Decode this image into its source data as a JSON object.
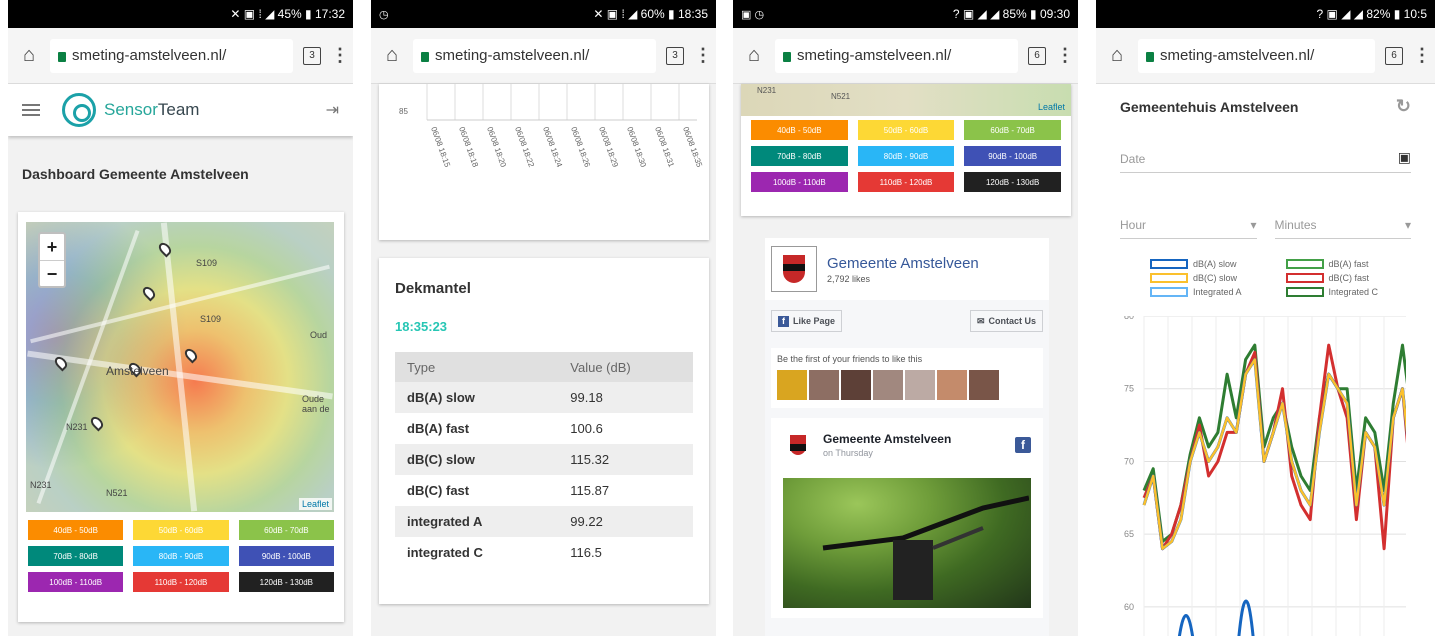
{
  "phones": [
    {
      "status": {
        "left": "",
        "text": "✕ ▣ ⁞ ◢ 45% ▮ 17:32"
      },
      "url": "smeting-amstelveen.nl/",
      "tabs": "3",
      "app": {
        "brand_a": "Sensor",
        "brand_b": "Team"
      },
      "dashboard_title": "Dashboard Gemeente Amstelveen",
      "map": {
        "labels": [
          "S109",
          "S109",
          "Amstelveen",
          "N231",
          "N231",
          "N521",
          "Oud",
          "Oude aan de"
        ],
        "attribution": "Leaflet"
      }
    },
    {
      "status": {
        "left": "◷",
        "text": "✕ ▣ ⁞ ◢ 60% ▮ 18:35"
      },
      "url": "smeting-amstelveen.nl/",
      "tabs": "3",
      "chart": {
        "ytick": "85",
        "xticks": [
          "06/08 18:15",
          "06/08 18:18",
          "06/08 18:20",
          "06/08 18:22",
          "06/08 18:24",
          "06/08 18:26",
          "06/08 18:29",
          "06/08 18:30",
          "06/08 18:31",
          "06/08 18:35"
        ]
      },
      "dekmantel": {
        "title": "Dekmantel",
        "time": "18:35:23",
        "col_type": "Type",
        "col_value": "Value (dB)",
        "rows": [
          {
            "type": "dB(A) slow",
            "value": "99.18"
          },
          {
            "type": "dB(A) fast",
            "value": "100.6"
          },
          {
            "type": "dB(C) slow",
            "value": "115.32"
          },
          {
            "type": "dB(C) fast",
            "value": "115.87"
          },
          {
            "type": "integrated A",
            "value": "99.22"
          },
          {
            "type": "integrated C",
            "value": "116.5"
          }
        ]
      }
    },
    {
      "status": {
        "left": "▣ ◷",
        "text": "? ▣ ◢ ◢ 85% ▮ 09:30"
      },
      "url": "smeting-amstelveen.nl/",
      "tabs": "6",
      "map_labels": [
        "N231",
        "N521",
        "Leaflet"
      ],
      "facebook": {
        "page_name": "Gemeente Amstelveen",
        "likes": "2,792 likes",
        "like_button": "Like Page",
        "contact_button": "Contact Us",
        "first_text": "Be the first of your friends to like this",
        "post_name": "Gemeente Amstelveen",
        "post_date": "on Thursday"
      }
    },
    {
      "status": {
        "left": "",
        "text": "? ▣ ◢ ◢ 82% ▮ 10:5"
      },
      "url": "smeting-amstelveen.nl/",
      "tabs": "6",
      "title": "Gemeentehuis Amstelveen",
      "date_placeholder": "Date",
      "hour_placeholder": "Hour",
      "minutes_placeholder": "Minutes",
      "legend": [
        {
          "name": "dB(A) slow",
          "color": "#1565c0"
        },
        {
          "name": "dB(A) fast",
          "color": "#43a047"
        },
        {
          "name": "dB(C) slow",
          "color": "#fbc02d"
        },
        {
          "name": "dB(C) fast",
          "color": "#d32f2f"
        },
        {
          "name": "Integrated A",
          "color": "#64b5f6"
        },
        {
          "name": "Integrated C",
          "color": "#2e7d32"
        }
      ]
    }
  ],
  "noise_legend": [
    {
      "label": "40dB - 50dB",
      "color": "#fb8c00"
    },
    {
      "label": "50dB - 60dB",
      "color": "#fdd835"
    },
    {
      "label": "60dB - 70dB",
      "color": "#8bc34a"
    },
    {
      "label": "70dB - 80dB",
      "color": "#00897b"
    },
    {
      "label": "80dB - 90dB",
      "color": "#29b6f6"
    },
    {
      "label": "90dB - 100dB",
      "color": "#3f51b5"
    },
    {
      "label": "100dB - 110dB",
      "color": "#9c27b0"
    },
    {
      "label": "110dB - 120dB",
      "color": "#e53935"
    },
    {
      "label": "120dB - 130dB",
      "color": "#212121"
    }
  ],
  "chart_data": {
    "type": "line",
    "title": "",
    "yticks": [
      60,
      65,
      70,
      75,
      80
    ],
    "ylim": [
      58,
      80
    ],
    "series": [
      {
        "name": "dB(A) slow",
        "values": [
          67,
          69,
          64,
          64.5,
          66,
          70,
          72,
          70,
          71,
          73,
          72,
          76,
          77,
          70,
          72,
          74,
          70,
          68,
          67,
          72,
          76,
          75,
          74,
          67,
          72,
          71,
          67,
          73,
          75,
          69,
          66
        ]
      },
      {
        "name": "dB(C) slow",
        "values": [
          67,
          69,
          64,
          64.5,
          66,
          70,
          72,
          70,
          71,
          73,
          72,
          76,
          77,
          70,
          72,
          74,
          70,
          68,
          67,
          72,
          76,
          75,
          74,
          67,
          72,
          71,
          67,
          73,
          75,
          69,
          66
        ]
      },
      {
        "name": "dB(C) fast",
        "values": [
          67.5,
          69,
          64,
          65,
          67,
          70,
          72.5,
          69,
          70,
          72,
          72,
          76,
          77.5,
          70,
          72,
          75,
          69,
          67,
          66,
          73,
          78,
          75,
          73,
          66,
          72,
          71,
          64,
          73,
          75,
          68,
          62
        ]
      },
      {
        "name": "Integrated C",
        "values": [
          68,
          69.5,
          64.5,
          65,
          67,
          70.5,
          73,
          71,
          72,
          76,
          73,
          77,
          78,
          71,
          73,
          74,
          71,
          69,
          68,
          73,
          76,
          75,
          75,
          68,
          73,
          72,
          68,
          74,
          78,
          73,
          67
        ]
      },
      {
        "name": "Integrated A",
        "values": [
          null,
          null,
          null,
          null,
          null,
          null,
          null,
          null,
          null,
          null,
          null,
          null,
          null,
          null,
          null,
          null,
          null,
          null,
          null,
          null,
          null,
          null,
          null,
          null,
          null,
          null,
          null,
          null,
          null,
          null,
          null
        ]
      }
    ]
  }
}
